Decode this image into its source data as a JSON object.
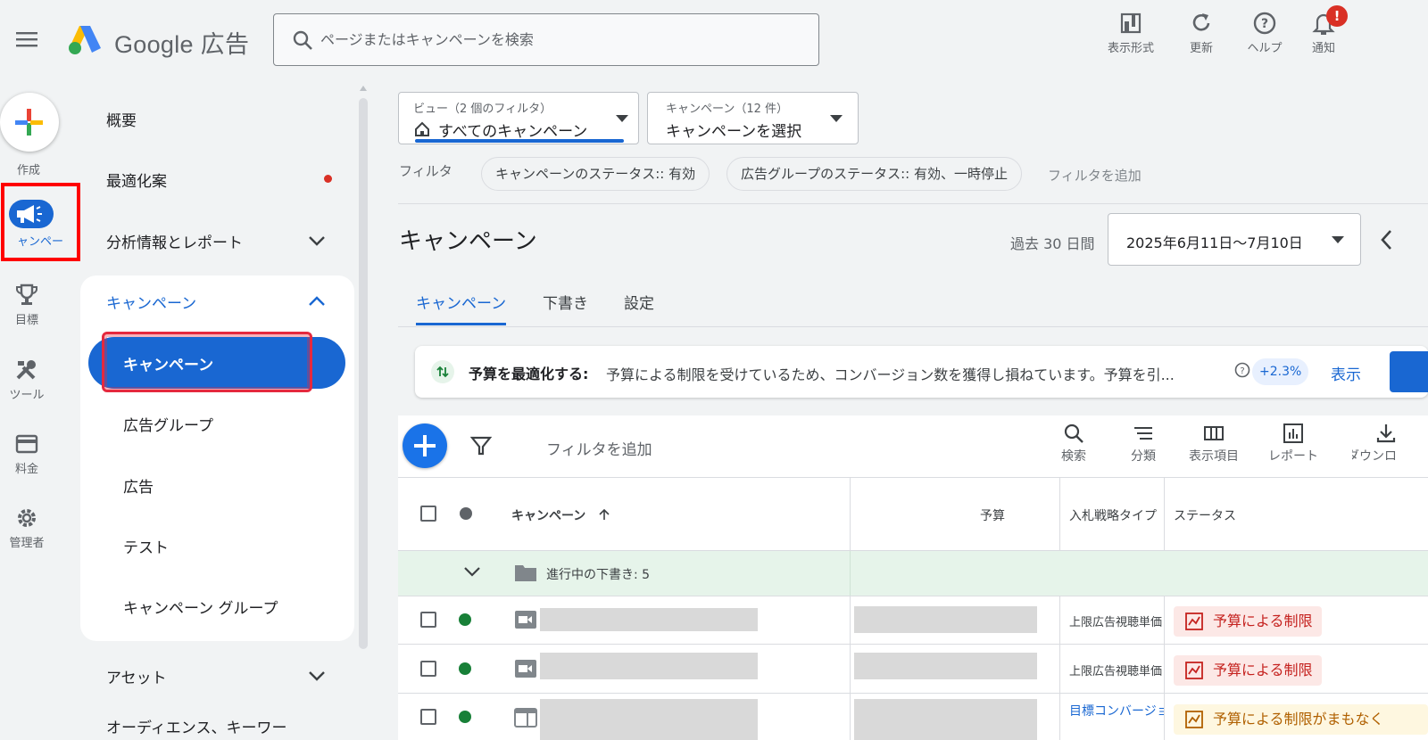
{
  "header": {
    "logo_text": "Google 広告",
    "search_placeholder": "ページまたはキャンペーンを検索",
    "toolbar": [
      {
        "label": "表示形式",
        "icon": "appearance-icon"
      },
      {
        "label": "更新",
        "icon": "refresh-icon"
      },
      {
        "label": "ヘルプ",
        "icon": "help-icon"
      },
      {
        "label": "通知",
        "icon": "bell-icon"
      }
    ],
    "notification_badge": "!"
  },
  "rail": {
    "create_label": "作成",
    "items": [
      {
        "label": "ャンペー",
        "icon": "campaigns-megaphone-icon"
      },
      {
        "label": "目標",
        "icon": "trophy-icon"
      },
      {
        "label": "ツール",
        "icon": "tools-icon"
      },
      {
        "label": "料金",
        "icon": "credit-card-icon"
      },
      {
        "label": "管理者",
        "icon": "gear-icon"
      }
    ]
  },
  "nav": {
    "overview": "概要",
    "recommendations": "最適化案",
    "insights": "分析情報とレポート",
    "campaigns_section": "キャンペーン",
    "sub": [
      "キャンペーン",
      "広告グループ",
      "広告",
      "テスト",
      "キャンペーン グループ"
    ],
    "assets": "アセット",
    "audiences_partial": "オーディエンス、キーワー"
  },
  "filters": {
    "view_label": "ビュー（2 個のフィルタ）",
    "view_value": "すべてのキャンペーン",
    "campaign_label": "キャンペーン（12 件）",
    "campaign_value": "キャンペーンを選択",
    "filter_label": "フィルタ",
    "chips": [
      "キャンペーンのステータス:: 有効",
      "広告グループのステータス:: 有効、一時停止"
    ],
    "add_filter": "フィルタを追加"
  },
  "page": {
    "title": "キャンペーン",
    "date_range_label": "過去 30 日間",
    "date_range_value": "2025年6月11日～7月10日",
    "tabs": [
      "キャンペーン",
      "下書き",
      "設定"
    ],
    "banner_title": "予算を最適化する:",
    "banner_text": "予算による制限を受けているため、コンバージョン数を獲得し損ねています。予算を引...",
    "banner_badge": "+2.3%",
    "banner_action": "表示"
  },
  "table": {
    "add_filter": "フィルタを追加",
    "tools": [
      {
        "label": "検索",
        "icon": "search-icon"
      },
      {
        "label": "分類",
        "icon": "segment-icon"
      },
      {
        "label": "表示項目",
        "icon": "columns-icon"
      },
      {
        "label": "レポート",
        "icon": "report-icon"
      },
      {
        "label": "ダウンロ",
        "icon": "download-icon"
      }
    ],
    "headers": {
      "campaign": "キャンペーン",
      "budget": "予算",
      "bid": "入札戦略タイプ",
      "status": "ステータス"
    },
    "draft_row": "進行中の下書き: 5",
    "rows": [
      {
        "bid": "上限広告視聴単価",
        "status": "予算による制限",
        "status_type": "limited",
        "icon": "video-icon"
      },
      {
        "bid": "上限広告視聴単価",
        "status": "予算による制限",
        "status_type": "limited",
        "icon": "video-icon"
      },
      {
        "bid": "目標コンバージョン単価",
        "status": "予算による制限がまもなく",
        "status_type": "warning",
        "icon": "display-icon"
      }
    ]
  },
  "colors": {
    "accent_blue": "#1967d2",
    "status_limited_bg": "#fce8e6",
    "status_limited_fg": "#c5221f",
    "draft_row_bg": "#e6f4ea",
    "enabled_green": "#188038"
  }
}
